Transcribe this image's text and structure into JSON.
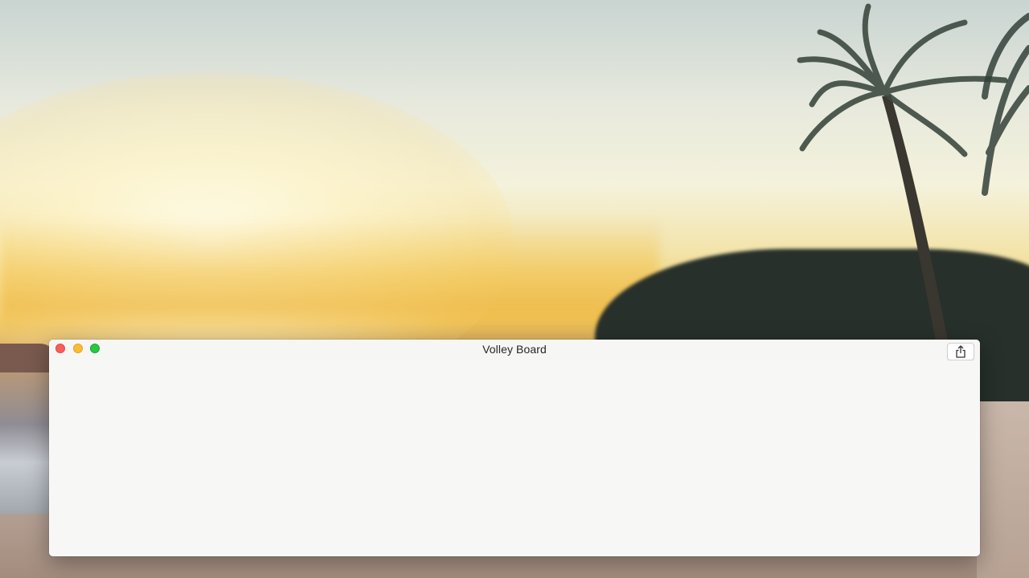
{
  "window": {
    "title": "Volley Board",
    "controls": {
      "close_color": "#fc5f57",
      "minimize_color": "#fdbc2e",
      "zoom_color": "#28c840"
    },
    "toolbar": {
      "share_icon": "share-icon"
    },
    "content_background": "#f7f7f5"
  },
  "wallpaper": {
    "scene": "beach-sunset-with-palm-trees",
    "colors": {
      "sky": "#e7e9dd",
      "sun_haze": "#f0c55a",
      "foliage": "#27302b",
      "sand": "#a38c7e"
    }
  }
}
